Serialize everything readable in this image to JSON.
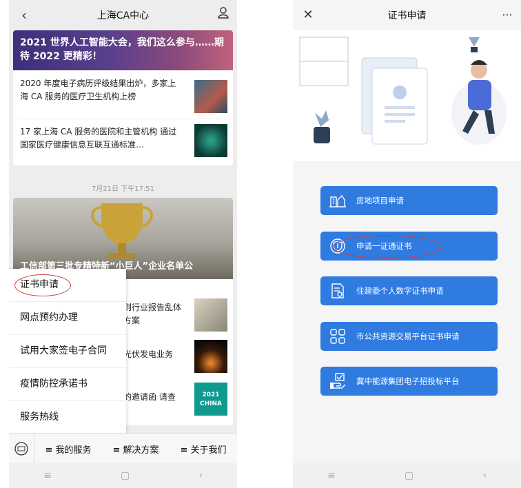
{
  "left": {
    "title": "上海CA中心",
    "banner_title": "2021 世界人工智能大会，我们这么参与……期待 2022 更精彩！",
    "news": [
      "2020 年度电子病历评级结果出炉，多家上海 CA 服务的医疗卫生机构上榜",
      "17 家上海 CA 服务的医院和主管机构 通过国家医疗健康信息互联互通标准…"
    ],
    "timestamp": "7月21日 下午17:51",
    "hero_title": "工信部第三批专精特新“小巨人”企业名单公",
    "right_snippets": [
      "则行业报告乱体方案",
      "光伏发电业务",
      "的邀请函 请查"
    ],
    "thumb_badge": "2021 CHINA",
    "popup": [
      "证书申请",
      "网点预约办理",
      "试用大家签电子合同",
      "疫情防控承诺书",
      "服务热线"
    ],
    "bottom_menu": [
      "≡ 我的服务",
      "≡ 解决方案",
      "≡ 关于我们"
    ],
    "sysnav": [
      "≡",
      "▢",
      "‹"
    ]
  },
  "right": {
    "title": "证书申请",
    "more": "···",
    "buttons": [
      {
        "label": "房地项目申请",
        "icon": "building-icon"
      },
      {
        "label": "申请一证通证书",
        "icon": "shield-certificate-icon"
      },
      {
        "label": "住建委个人数字证书申请",
        "icon": "document-certificate-icon"
      },
      {
        "label": "市公共资源交易平台证书申请",
        "icon": "grid-apps-icon"
      },
      {
        "label": "冀中能源集团电子招投标平台",
        "icon": "hand-checkbox-icon"
      }
    ],
    "sysnav": [
      "≡",
      "▢",
      "‹"
    ]
  },
  "colors": {
    "button": "#2f7be0",
    "highlight": "#d23a3a"
  }
}
